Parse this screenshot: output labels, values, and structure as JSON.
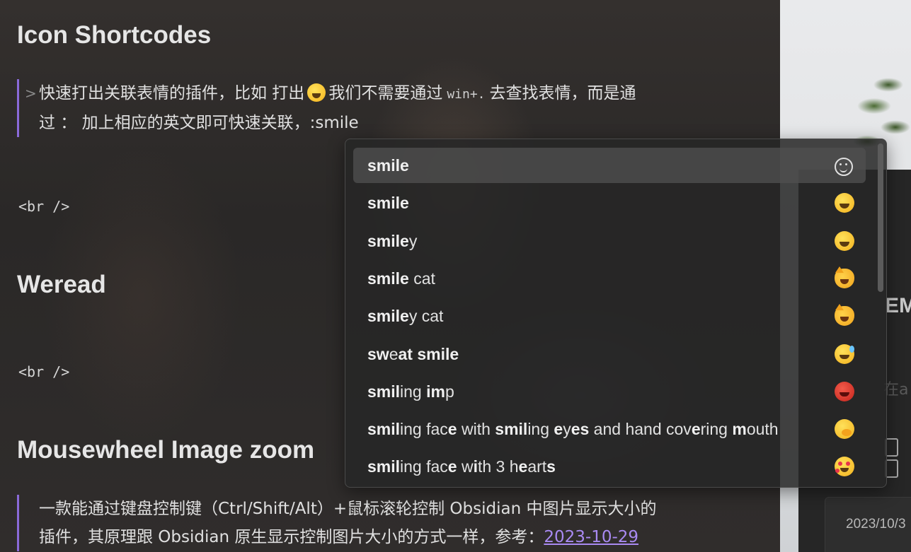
{
  "editor": {
    "heading_icon_shortcodes": "Icon Shortcodes",
    "quote1": {
      "line1_a": "快速打出关联表情的插件，比如 打出",
      "line1_b": "我们不需要通过",
      "line1_code": "win+.",
      "line1_c": "去查找表情，而是通",
      "line2": "过 ： 加上相应的英文即可快速关联，:smile"
    },
    "br1": "<br />",
    "heading_weread": "Weread",
    "br2": "<br />",
    "heading_mousewheel": "Mousewheel Image zoom",
    "quote2": {
      "line1": "一款能通过键盘控制键（Ctrl/Shift/Alt）+鼠标滚轮控制 Obsidian 中图片显示大小的",
      "line2_a": "插件，其原理跟 Obsidian 原生显示控制图片大小的方式一样，参考：",
      "line2_link": "2023-10-29"
    }
  },
  "suggestions": [
    {
      "parts": [
        [
          "b",
          "smile"
        ]
      ],
      "emoji": "outline-smile-icon",
      "selected": true
    },
    {
      "parts": [
        [
          "b",
          "smile"
        ]
      ],
      "emoji": "grinning-squinting-face-icon",
      "selected": false
    },
    {
      "parts": [
        [
          "b",
          "smile"
        ],
        [
          "n",
          "y"
        ]
      ],
      "emoji": "smiley-face-icon",
      "selected": false
    },
    {
      "parts": [
        [
          "b",
          "smile"
        ],
        [
          "n",
          " cat"
        ]
      ],
      "emoji": "smile-cat-icon",
      "selected": false
    },
    {
      "parts": [
        [
          "b",
          "smile"
        ],
        [
          "n",
          "y cat"
        ]
      ],
      "emoji": "smiley-cat-icon",
      "selected": false
    },
    {
      "parts": [
        [
          "b",
          "sw"
        ],
        [
          "n",
          "e"
        ],
        [
          "b",
          "at"
        ],
        [
          "n",
          " "
        ],
        [
          "b",
          "smile"
        ]
      ],
      "emoji": "sweat-smile-icon",
      "selected": false
    },
    {
      "parts": [
        [
          "b",
          "smil"
        ],
        [
          "n",
          "ing "
        ],
        [
          "b",
          "im"
        ],
        [
          "n",
          "p"
        ]
      ],
      "emoji": "smiling-imp-icon",
      "selected": false
    },
    {
      "parts": [
        [
          "b",
          "smil"
        ],
        [
          "n",
          "ing fac"
        ],
        [
          "b",
          "e"
        ],
        [
          "n",
          " with "
        ],
        [
          "b",
          "smil"
        ],
        [
          "n",
          "ing "
        ],
        [
          "b",
          "e"
        ],
        [
          "n",
          "y"
        ],
        [
          "b",
          "es"
        ],
        [
          "n",
          " and hand cov"
        ],
        [
          "b",
          "e"
        ],
        [
          "n",
          "ring "
        ],
        [
          "b",
          "m"
        ],
        [
          "n",
          "outh"
        ]
      ],
      "emoji": "hand-over-mouth-icon",
      "selected": false
    },
    {
      "parts": [
        [
          "b",
          "smil"
        ],
        [
          "n",
          "ing fac"
        ],
        [
          "b",
          "e"
        ],
        [
          "n",
          " w"
        ],
        [
          "b",
          "i"
        ],
        [
          "n",
          "th 3 h"
        ],
        [
          "b",
          "e"
        ],
        [
          "n",
          "art"
        ],
        [
          "b",
          "s"
        ]
      ],
      "emoji": "smiling-hearts-icon",
      "selected": false
    }
  ],
  "right_pane": {
    "em_text": "EM",
    "zai_text": "在a",
    "date_text": "2023/10/3"
  }
}
